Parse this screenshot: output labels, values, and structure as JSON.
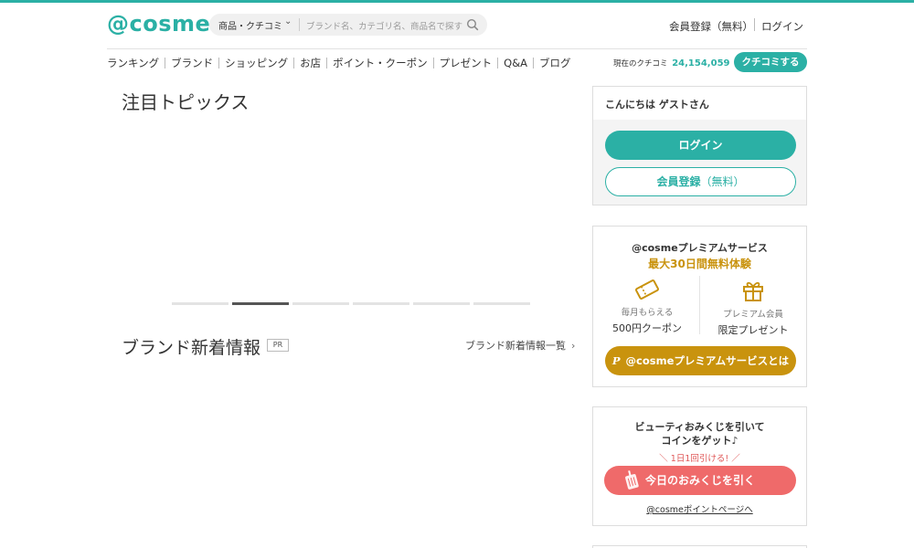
{
  "brand_color": "#2bb0a5",
  "premium_color": "#c9930e",
  "omikuji_color": "#ef6a6a",
  "header": {
    "logo": "@cosme",
    "search_category": "商品・クチコミ",
    "search_placeholder": "ブランド名、カテゴリ名、商品名で探す",
    "register": "会員登録（無料）",
    "login": "ログイン"
  },
  "nav": {
    "items": [
      "ランキング",
      "ブランド",
      "ショッピング",
      "お店",
      "ポイント・クーポン",
      "プレゼント",
      "Q&A",
      "ブログ"
    ],
    "kuchikomi_label": "現在のクチコミ",
    "kuchikomi_count": "24,154,059",
    "kuchikomi_unit": "件",
    "kuchikomi_button": "クチコミする"
  },
  "main": {
    "topics_title": "注目トピックス",
    "carousel_active_index": 1,
    "carousel_count": 6,
    "brand_news_title": "ブランド新着情報",
    "pr_badge": "PR",
    "brand_news_link": "ブランド新着情報一覧"
  },
  "sidebar": {
    "greeting": "こんにちは ゲストさん",
    "login_button": "ログイン",
    "register_button_main": "会員登録",
    "register_button_sub": "（無料）",
    "premium": {
      "title": "@cosmeプレミアムサービス",
      "subtitle": "最大30日間無料体験",
      "benefit1_small": "毎月もらえる",
      "benefit1_main": "500円クーポン",
      "benefit2_small": "プレミアム会員",
      "benefit2_main": "限定プレゼント",
      "button": "@cosmeプレミアムサービスとは"
    },
    "omikuji": {
      "line1": "ビューティおみくじを引いて",
      "line2": "コインをゲット♪",
      "once": "＼ 1日1回引ける! ／",
      "button": "今日のおみくじを引く",
      "link": "@cosmeポイントページへ"
    }
  }
}
